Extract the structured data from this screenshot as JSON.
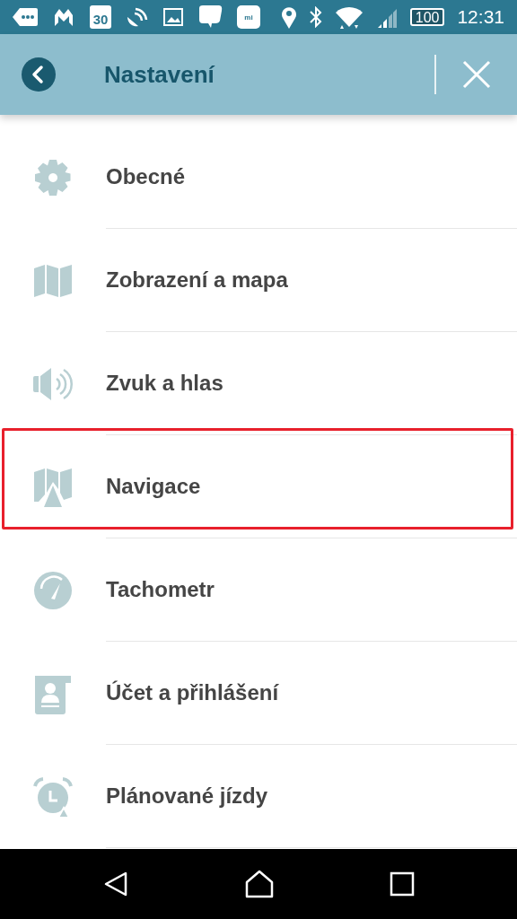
{
  "status_bar": {
    "calendar_day": "30",
    "mi_label": "mi",
    "battery": "100",
    "time": "12:31"
  },
  "header": {
    "title": "Nastavení"
  },
  "items": [
    {
      "label": "Obecné",
      "highlighted": false
    },
    {
      "label": "Zobrazení a mapa",
      "highlighted": false
    },
    {
      "label": "Zvuk a hlas",
      "highlighted": false
    },
    {
      "label": "Navigace",
      "highlighted": true
    },
    {
      "label": "Tachometr",
      "highlighted": false
    },
    {
      "label": "Účet a přihlášení",
      "highlighted": false
    },
    {
      "label": "Plánované jízdy",
      "highlighted": false
    }
  ]
}
